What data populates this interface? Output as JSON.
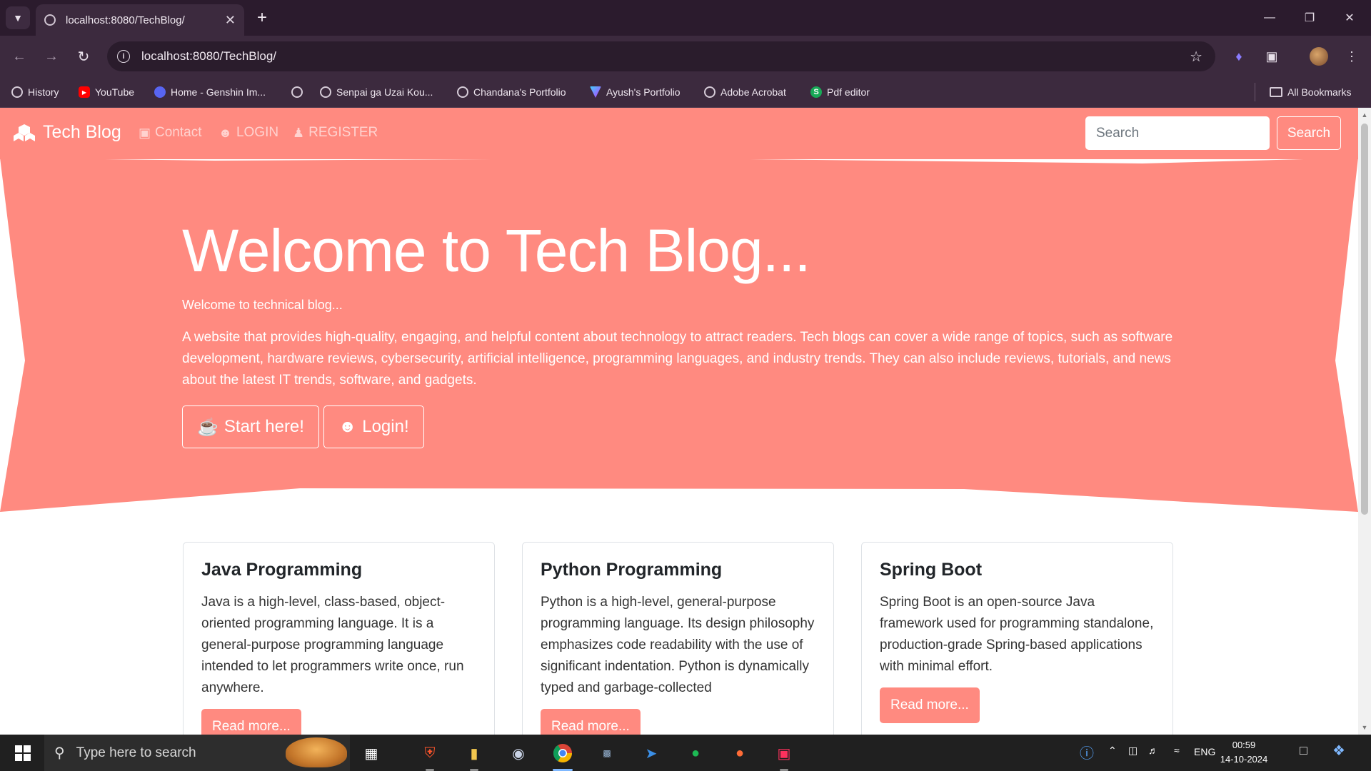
{
  "browser": {
    "tab_title": "localhost:8080/TechBlog/",
    "url": "localhost:8080/TechBlog/",
    "bookmarks": [
      {
        "label": "History",
        "icon": "history-icon"
      },
      {
        "label": "YouTube",
        "icon": "youtube-icon"
      },
      {
        "label": "Home - Genshin Im...",
        "icon": "discord-icon"
      },
      {
        "label": "",
        "icon": "globe-icon"
      },
      {
        "label": "Senpai ga Uzai Kou...",
        "icon": "globe-icon"
      },
      {
        "label": "Chandana's Portfolio",
        "icon": "globe-icon"
      },
      {
        "label": "Ayush's Portfolio",
        "icon": "vite-icon"
      },
      {
        "label": "Adobe Acrobat",
        "icon": "globe-icon"
      },
      {
        "label": "Pdf editor",
        "icon": "s-icon"
      }
    ],
    "all_bookmarks": "All Bookmarks"
  },
  "site": {
    "brand": "Tech Blog",
    "nav": {
      "contact": "Contact",
      "login": "LOGIN",
      "register": "REGISTER"
    },
    "search": {
      "placeholder": "Search",
      "button": "Search"
    },
    "accent_color": "#ff8a80"
  },
  "hero": {
    "title": "Welcome to Tech Blog...",
    "subtitle": "Welcome to technical blog...",
    "description": "A website that provides high-quality, engaging, and helpful content about technology to attract readers. Tech blogs can cover a wide range of topics, such as software development, hardware reviews, cybersecurity, artificial intelligence, programming languages, and industry trends. They can also include reviews, tutorials, and news about the latest IT trends, software, and gadgets.",
    "start_button": "Start here!",
    "login_button": "Login!"
  },
  "cards": [
    {
      "title": "Java Programming",
      "text": "Java is a high-level, class-based, object-oriented programming language. It is a general-purpose programming language intended to let programmers write once, run anywhere.",
      "button": "Read more..."
    },
    {
      "title": "Python Programming",
      "text": "Python is a high-level, general-purpose programming language. Its design philosophy emphasizes code readability with the use of significant indentation. Python is dynamically typed and garbage-collected",
      "button": "Read more..."
    },
    {
      "title": "Spring Boot",
      "text": "Spring Boot is an open-source Java framework used for programming standalone, production-grade Spring-based applications with minimal effort.",
      "button": "Read more..."
    }
  ],
  "taskbar": {
    "search_placeholder": "Type here to search",
    "language": "ENG",
    "time": "00:59",
    "date": "14-10-2024"
  }
}
